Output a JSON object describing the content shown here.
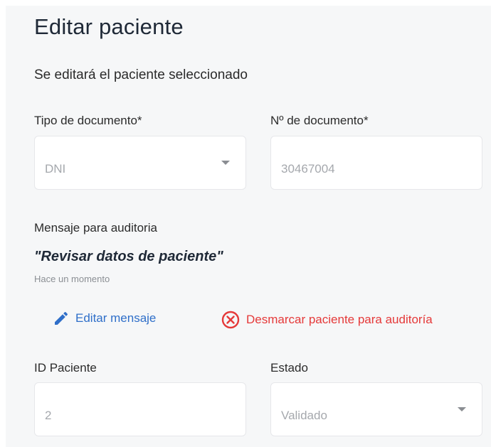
{
  "form": {
    "title": "Editar paciente",
    "subtitle": "Se editará el paciente seleccionado",
    "tipo_documento": {
      "label": "Tipo de documento*",
      "value": "DNI"
    },
    "numero_documento": {
      "label": "Nº de documento*",
      "value": "30467004"
    },
    "auditoria": {
      "label": "Mensaje para auditoria",
      "message": "\"Revisar datos de paciente\"",
      "time": "Hace un momento"
    },
    "actions": {
      "edit_label": "Editar mensaje",
      "unmark_label": "Desmarcar paciente para auditoría"
    },
    "id_paciente": {
      "label": "ID Paciente",
      "value": "2"
    },
    "estado": {
      "label": "Estado",
      "value": "Validado"
    }
  },
  "colors": {
    "edit": "#2f6fc9",
    "unmark": "#e53939"
  },
  "icons": {
    "edit": "pencil-icon",
    "unmark": "close-circle-icon",
    "dropdown": "chevron-down-icon"
  }
}
